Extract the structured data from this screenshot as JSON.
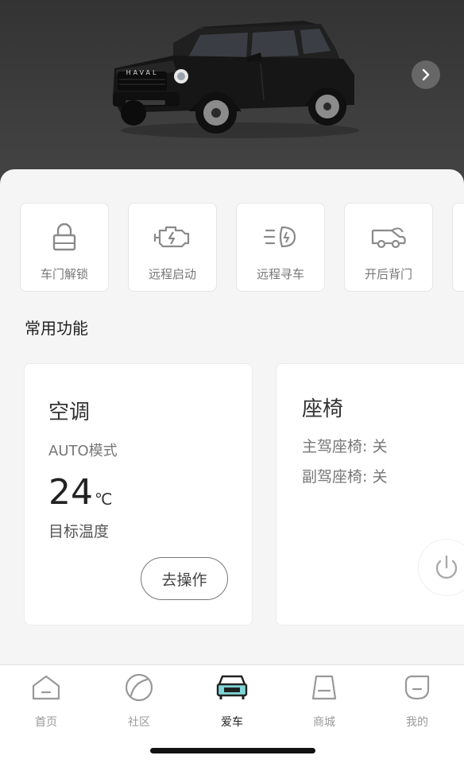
{
  "hero": {
    "car_brand": "HAVAL",
    "next_icon": "chevron-right-icon"
  },
  "quick_actions": [
    {
      "label": "车门解锁",
      "icon": "lock-icon"
    },
    {
      "label": "远程启动",
      "icon": "engine-icon"
    },
    {
      "label": "远程寻车",
      "icon": "headlight-icon"
    },
    {
      "label": "开后背门",
      "icon": "tailgate-icon"
    }
  ],
  "common_functions": {
    "title": "常用功能",
    "ac": {
      "title": "空调",
      "mode": "AUTO模式",
      "temperature": "24",
      "unit": "℃",
      "desc": "目标温度",
      "action_label": "去操作"
    },
    "seat": {
      "title": "座椅",
      "driver": "主驾座椅: 关",
      "passenger": "副驾座椅: 关",
      "power_icon": "power-icon"
    }
  },
  "tabbar": {
    "items": [
      {
        "label": "首页",
        "icon": "home-icon",
        "active": false
      },
      {
        "label": "社区",
        "icon": "community-icon",
        "active": false
      },
      {
        "label": "爱车",
        "icon": "car-icon",
        "active": true
      },
      {
        "label": "商城",
        "icon": "shop-icon",
        "active": false
      },
      {
        "label": "我的",
        "icon": "profile-icon",
        "active": false
      }
    ]
  },
  "colors": {
    "accent_teal": "#7fd6d6",
    "hero_bg": "#3a3a3a",
    "page_bg": "#f5f5f5"
  }
}
